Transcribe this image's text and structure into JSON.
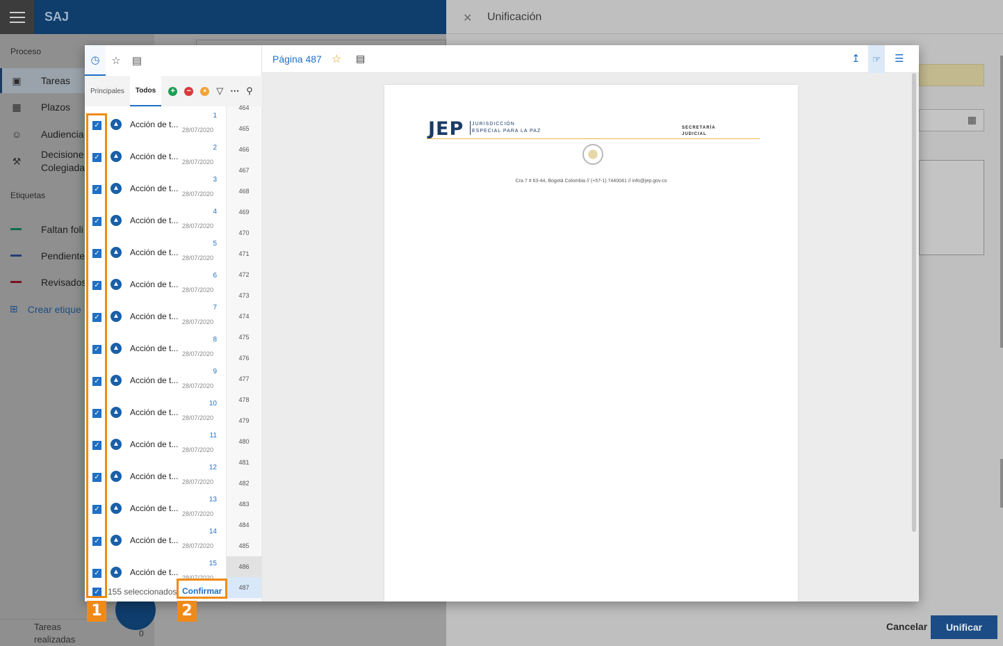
{
  "app": {
    "title": "SAJ"
  },
  "sidebar": {
    "section_process": "Proceso",
    "items": [
      {
        "label": "Tareas",
        "icon": "book-icon"
      },
      {
        "label": "Plazos",
        "icon": "calendar-icon"
      },
      {
        "label": "Audiencia",
        "icon": "people-icon"
      },
      {
        "label": "Decisione Colegiada",
        "icon": "gavel-icon"
      }
    ],
    "section_tags": "Etiquetas",
    "tags": [
      {
        "label": "Faltan foli",
        "color": "#0e6b4f"
      },
      {
        "label": "Pendiente",
        "color": "#223f7a"
      },
      {
        "label": "Revisados",
        "color": "#7b1220"
      }
    ],
    "create_tag": "Crear etique",
    "footer_label": "Tareas realizadas",
    "footer_count": "0"
  },
  "right_panel": {
    "title": "Unificación",
    "cancel": "Cancelar",
    "unify": "Unificar"
  },
  "modal": {
    "tabs": [
      "clock-icon",
      "star-icon",
      "comment-icon"
    ],
    "subtabs": [
      "Principales",
      "Todos"
    ],
    "documents": [
      {
        "num": "1",
        "title": "Acción de t...",
        "date": "28/07/2020"
      },
      {
        "num": "2",
        "title": "Acción de t...",
        "date": "28/07/2020"
      },
      {
        "num": "3",
        "title": "Acción de t...",
        "date": "28/07/2020"
      },
      {
        "num": "4",
        "title": "Acción de t...",
        "date": "28/07/2020"
      },
      {
        "num": "5",
        "title": "Acción de t...",
        "date": "28/07/2020"
      },
      {
        "num": "6",
        "title": "Acción de t...",
        "date": "28/07/2020"
      },
      {
        "num": "7",
        "title": "Acción de t...",
        "date": "28/07/2020"
      },
      {
        "num": "8",
        "title": "Acción de t...",
        "date": "28/07/2020"
      },
      {
        "num": "9",
        "title": "Acción de t...",
        "date": "28/07/2020"
      },
      {
        "num": "10",
        "title": "Acción de t...",
        "date": "28/07/2020"
      },
      {
        "num": "11",
        "title": "Acción de t...",
        "date": "28/07/2020"
      },
      {
        "num": "12",
        "title": "Acción de t...",
        "date": "28/07/2020"
      },
      {
        "num": "13",
        "title": "Acción de t...",
        "date": "28/07/2020"
      },
      {
        "num": "14",
        "title": "Acción de t...",
        "date": "28/07/2020"
      },
      {
        "num": "15",
        "title": "Acción de t...",
        "date": "28/07/2020"
      }
    ],
    "pages": [
      "464",
      "465",
      "466",
      "467",
      "468",
      "469",
      "470",
      "471",
      "472",
      "473",
      "474",
      "475",
      "476",
      "477",
      "478",
      "479",
      "480",
      "481",
      "482",
      "483",
      "484",
      "485",
      "486",
      "487"
    ],
    "selected_count": "155 seleccionados",
    "confirm": "Confirmar",
    "viewer": {
      "page_label": "Página 487",
      "doc": {
        "logo": "JEP",
        "org_line1": "JURISDICCIÓN",
        "org_line2": "ESPECIAL PARA LA PAZ",
        "dept_line1": "SECRETARÍA",
        "dept_line2": "JUDICIAL",
        "address": "Cra 7 # 63-44, Bogotá Colombia // (+57-1) 7440041 // info@jep.gov.co"
      }
    }
  },
  "annotations": {
    "badge1": "1",
    "badge2": "2",
    "color": "#f08a17"
  }
}
